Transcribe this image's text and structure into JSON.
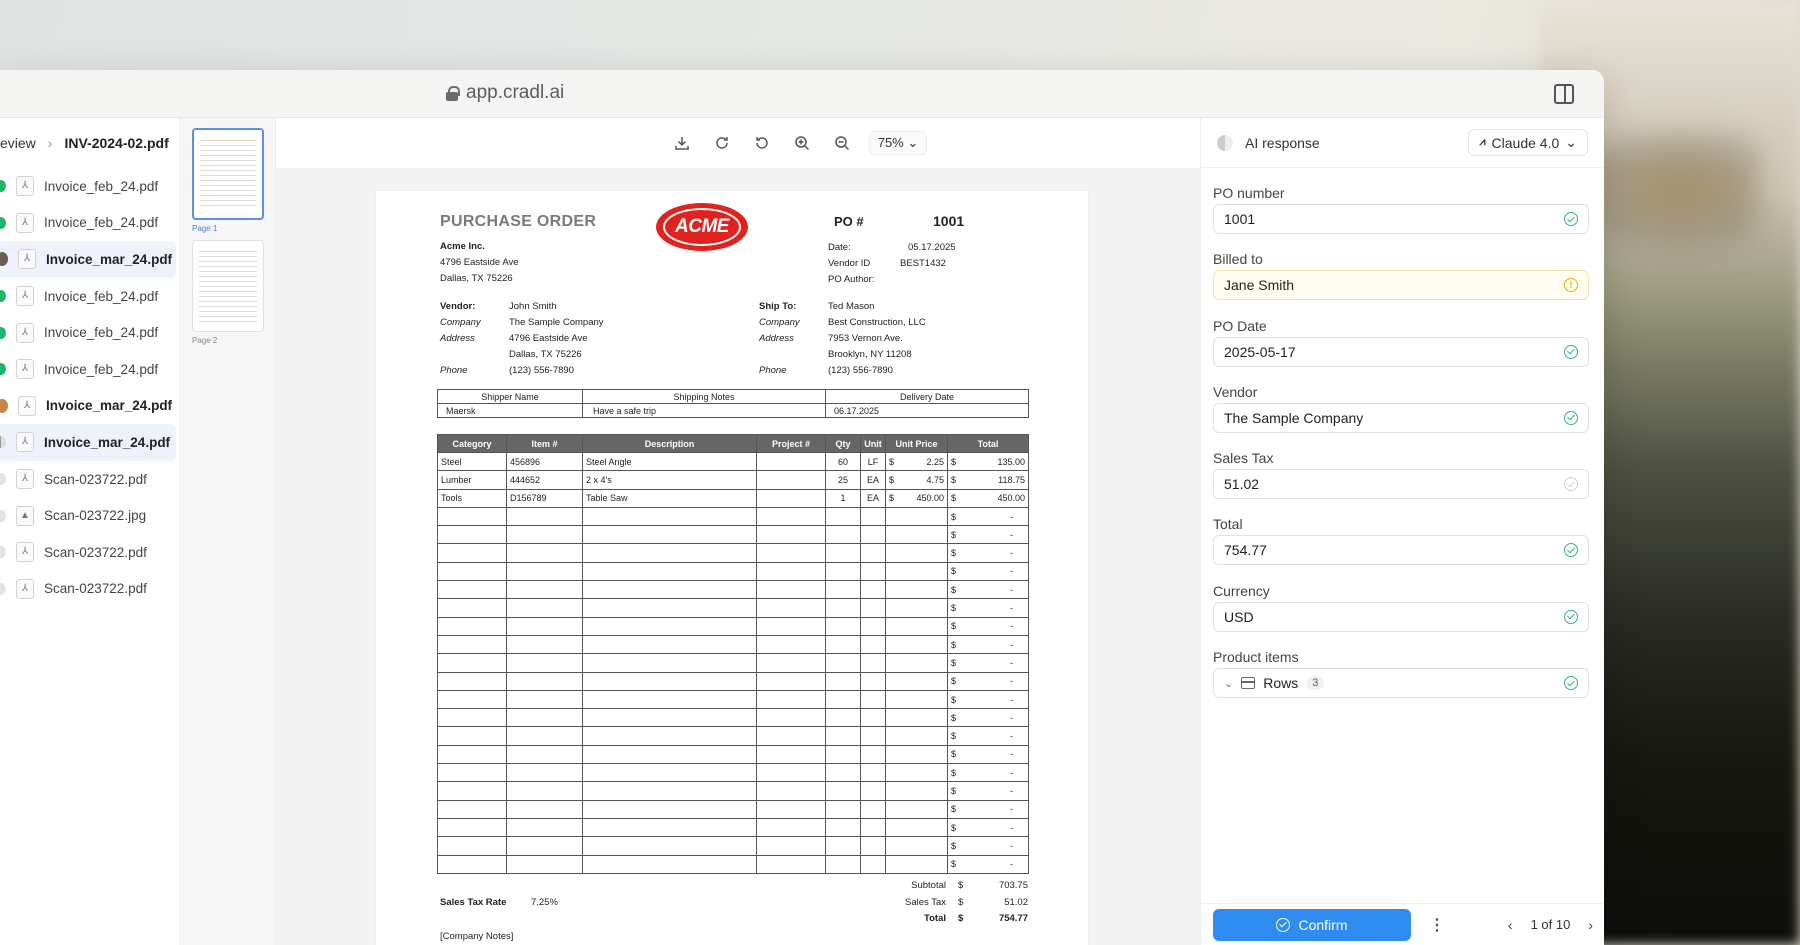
{
  "browser": {
    "url": "app.cradl.ai"
  },
  "breadcrumb": {
    "parent": "eview",
    "current": "INV-2024-02.pdf"
  },
  "files": [
    {
      "name": "Invoice_feb_24.pdf",
      "status": "ok",
      "icon": "pdf-icon"
    },
    {
      "name": "Invoice_feb_24.pdf",
      "status": "ok",
      "icon": "pdf-icon"
    },
    {
      "name": "Invoice_mar_24.pdf",
      "status": "avatar",
      "icon": "pdf-icon",
      "active": true
    },
    {
      "name": "Invoice_feb_24.pdf",
      "status": "ok",
      "icon": "pdf-icon"
    },
    {
      "name": "Invoice_feb_24.pdf",
      "status": "ok",
      "icon": "pdf-icon"
    },
    {
      "name": "Invoice_feb_24.pdf",
      "status": "ok",
      "icon": "pdf-icon"
    },
    {
      "name": "Invoice_mar_24.pdf",
      "status": "avatar2",
      "icon": "pdf-icon"
    },
    {
      "name": "Invoice_mar_24.pdf",
      "status": "half",
      "icon": "pdf-icon",
      "active": true
    },
    {
      "name": "Scan-023722.pdf",
      "status": "empty",
      "icon": "pdf-icon"
    },
    {
      "name": "Scan-023722.jpg",
      "status": "empty",
      "icon": "image-icon"
    },
    {
      "name": "Scan-023722.pdf",
      "status": "empty",
      "icon": "pdf-icon"
    },
    {
      "name": "Scan-023722.pdf",
      "status": "empty",
      "icon": "pdf-icon"
    }
  ],
  "thumbnails": [
    {
      "label": "Page 1"
    },
    {
      "label": "Page 2"
    }
  ],
  "toolbar": {
    "zoom": "75%"
  },
  "document": {
    "title": "PURCHASE ORDER",
    "logo_text": "ACME",
    "po_label": "PO #",
    "po_number": "1001",
    "company": "Acme Inc.",
    "company_address1": "4796 Eastside Ave",
    "company_address2": "Dallas, TX  75226",
    "date_label": "Date:",
    "date_value": "05.17.2025",
    "vendor_id_label": "Vendor ID",
    "vendor_id_value": "BEST1432",
    "po_author_label": "PO Author:",
    "vendor_label": "Vendor:",
    "vendor_name": "John Smith",
    "company_label": "Company",
    "vendor_company": "The Sample Company",
    "address_label": "Address",
    "vendor_address1": "4796 Eastside Ave",
    "vendor_address2": "Dallas, TX  75226",
    "phone_label": "Phone",
    "vendor_phone": "(123) 556-7890",
    "ship_to_label": "Ship To:",
    "ship_name": "Ted Mason",
    "ship_company": "Best Construction, LLC",
    "ship_address1": "7953 Vernon Ave.",
    "ship_address2": "Brooklyn, NY 11208",
    "ship_phone": "(123) 556-7890",
    "shipping_headers": [
      "Shipper Name",
      "Shipping Notes",
      "Delivery Date"
    ],
    "shipping_row": [
      "Maersk",
      "Have a safe trip",
      "06.17.2025"
    ],
    "item_headers": [
      "Category",
      "Item #",
      "Description",
      "Project #",
      "Qty",
      "Unit",
      "Unit Price",
      "Total"
    ],
    "items": [
      {
        "category": "Steel",
        "item": "456896",
        "description": "Steel Angle",
        "project": "",
        "qty": "60",
        "unit": "LF",
        "price": "2.25",
        "total": "135.00"
      },
      {
        "category": "Lumber",
        "item": "444652",
        "description": "2 x 4's",
        "project": "",
        "qty": "25",
        "unit": "EA",
        "price": "4.75",
        "total": "118.75"
      },
      {
        "category": "Tools",
        "item": "D156789",
        "description": "Table Saw",
        "project": "",
        "qty": "1",
        "unit": "EA",
        "price": "450.00",
        "total": "450.00"
      }
    ],
    "currency_symbol": "$",
    "empty_total": "-",
    "empty_rows": 20,
    "subtotal_label": "Subtotal",
    "subtotal": "703.75",
    "tax_rate_label": "Sales Tax Rate",
    "tax_rate": "7.25%",
    "sales_tax_label": "Sales Tax",
    "sales_tax": "51.02",
    "total_label": "Total",
    "total": "754.77",
    "notes": "[Company Notes]"
  },
  "ai_panel": {
    "title": "AI response",
    "model": "Claude 4.0",
    "fields": [
      {
        "label": "PO number",
        "value": "1001",
        "state": "ok"
      },
      {
        "label": "Billed to",
        "value": "Jane Smith",
        "state": "warn"
      },
      {
        "label": "PO Date",
        "value": "2025-05-17",
        "state": "ok"
      },
      {
        "label": "Vendor",
        "value": "The Sample Company",
        "state": "ok"
      },
      {
        "label": "Sales Tax",
        "value": "51.02",
        "state": "faint"
      },
      {
        "label": "Total",
        "value": "754.77",
        "state": "ok"
      },
      {
        "label": "Currency",
        "value": "USD",
        "state": "ok"
      }
    ],
    "product_items": {
      "label": "Product items",
      "rows_label": "Rows",
      "rows_count": "3"
    },
    "confirm_label": "Confirm",
    "pager_text": "1 of 10"
  },
  "colors": {
    "accent": "#2f8cf0",
    "ok": "#2dbb72",
    "warn": "#e5b500"
  }
}
